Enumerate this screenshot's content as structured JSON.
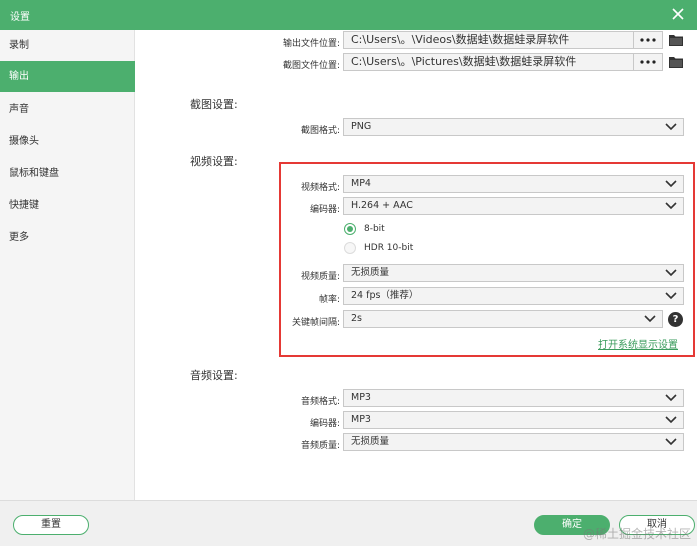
{
  "window": {
    "title": "设置"
  },
  "sidebar": {
    "items": [
      {
        "label": "录制"
      },
      {
        "label": "输出"
      },
      {
        "label": "声音"
      },
      {
        "label": "摄像头"
      },
      {
        "label": "鼠标和键盘"
      },
      {
        "label": "快捷键"
      },
      {
        "label": "更多"
      }
    ],
    "active_index": 1
  },
  "output": {
    "file_location_label": "输出文件位置:",
    "file_location_value": "C:\\Users\\。\\Videos\\数据蛙\\数据蛙录屏软件",
    "screenshot_location_label": "截图文件位置:",
    "screenshot_location_value": "C:\\Users\\。\\Pictures\\数据蛙\\数据蛙录屏软件"
  },
  "screenshot_settings": {
    "heading": "截图设置:",
    "format_label": "截图格式:",
    "format_value": "PNG"
  },
  "video_settings": {
    "heading": "视频设置:",
    "format_label": "视频格式:",
    "format_value": "MP4",
    "encoder_label": "编码器:",
    "encoder_value": "H.264 + AAC",
    "bit_8_label": "8-bit",
    "hdr_label": "HDR 10-bit",
    "quality_label": "视频质量:",
    "quality_value": "无损质量",
    "fps_label": "帧率:",
    "fps_value": "24 fps（推荐）",
    "keyframe_label": "关键帧间隔:",
    "keyframe_value": "2s",
    "help_glyph": "?",
    "open_display_link": "打开系统显示设置"
  },
  "audio_settings": {
    "heading": "音频设置:",
    "format_label": "音频格式:",
    "format_value": "MP3",
    "encoder_label": "编码器:",
    "encoder_value": "MP3",
    "quality_label": "音频质量:",
    "quality_value": "无损质量"
  },
  "footer": {
    "reset_label": "重置",
    "ok_label": "确定",
    "cancel_label": "取消",
    "watermark": "@稀土掘金技术社区"
  },
  "colors": {
    "accent": "#4caf6e",
    "highlight_box": "#e53935",
    "link": "#3a9b5c"
  },
  "icons": {
    "close": "close-icon",
    "more": "more-dots-icon",
    "folder": "folder-icon",
    "dropdown": "chevron-down-icon",
    "help": "help-icon"
  }
}
